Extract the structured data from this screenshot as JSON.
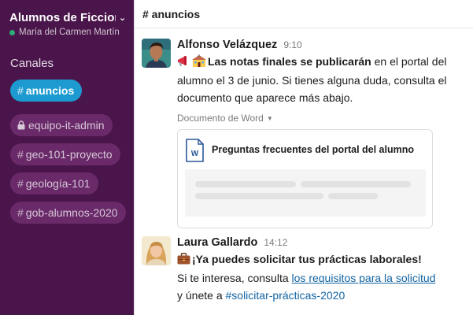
{
  "sidebar": {
    "workspace_name": "Alumnos de Ficcion...",
    "user_name": "María del Carmen Martín",
    "presence_color": "#2bac76",
    "section_title": "Canales",
    "channels": [
      {
        "label": "anuncios",
        "active": true,
        "private": false
      },
      {
        "label": "equipo-it-admin",
        "active": false,
        "private": true
      },
      {
        "label": "geo-101-proyecto",
        "active": false,
        "private": false
      },
      {
        "label": "geología-101",
        "active": false,
        "private": false
      },
      {
        "label": "gob-alumnos-2020",
        "active": false,
        "private": false
      }
    ],
    "hash_glyph": "#"
  },
  "header": {
    "channel_title": "# anuncios"
  },
  "messages": [
    {
      "author": "Alfonso Velázquez",
      "time": "9:10",
      "emoji": [
        "megaphone-icon",
        "school-icon"
      ],
      "bold_text": "Las notas finales se publicarán",
      "text_rest": " en el portal del alumno el 3 de junio. Si tienes alguna duda, consulta el documento que aparece más abajo.",
      "attachment_label": "Documento de Word",
      "attachment_title": "Preguntas frecuentes del portal del alumno",
      "file_icon_letter": "W"
    },
    {
      "author": "Laura Gallardo",
      "time": "14:12",
      "emoji": [
        "briefcase-icon"
      ],
      "bold_text": "¡Ya puedes solicitar tus prácticas laborales!",
      "line2_prefix": "Si te interesa, consulta ",
      "line2_link": "los requisitos para la solicitud",
      "line3_prefix": "y únete a ",
      "line3_channel": "#solicitar-prácticas-2020"
    }
  ],
  "colors": {
    "sidebar_bg": "#4a154b",
    "active_channel": "#1d9bd1",
    "link": "#1264a3"
  }
}
